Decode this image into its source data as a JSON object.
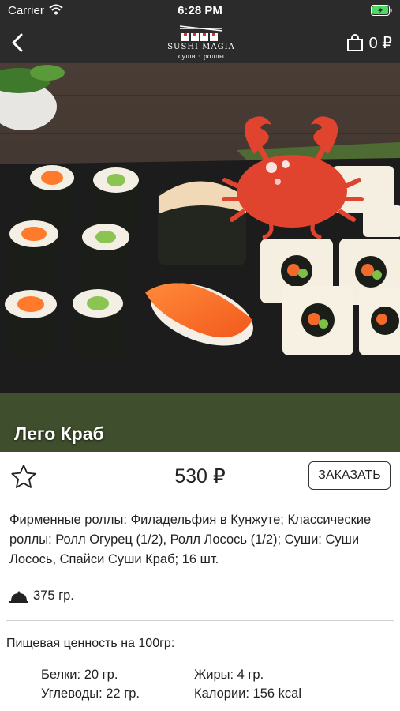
{
  "status_bar": {
    "carrier": "Carrier",
    "time": "6:28 PM"
  },
  "header": {
    "logo_brand": "SUSHI MAGIA",
    "logo_tagline_left": "суши",
    "logo_tagline_right": "роллы",
    "cart_total": "0 ₽"
  },
  "product": {
    "title": "Лего Краб",
    "price": "530 ₽",
    "order_label": "ЗАКАЗАТЬ",
    "description": "Фирменные роллы: Филадельфия в Кунжуте; Классические роллы: Ролл Огурец (1/2), Ролл Лосось (1/2); Суши: Суши Лосось, Спайси Суши Краб; 16 шт.",
    "weight": "375 гр."
  },
  "nutrition": {
    "title": "Пищевая ценность на 100гр:",
    "protein": "Белки: 20 гр.",
    "fat": "Жиры: 4 гр.",
    "carbs": "Углеводы: 22 гр.",
    "calories": "Калории: 156 kcal"
  },
  "icons": [
    "back-arrow-icon",
    "logo-icon",
    "shopping-bag-icon",
    "favorite-star-icon",
    "dish-cloche-icon",
    "crab-badge-icon",
    "wifi-icon",
    "battery-icon"
  ],
  "colors": {
    "bar_background": "#2b2b2b",
    "crab": "#e0432e",
    "accent_red": "#e0302a"
  }
}
